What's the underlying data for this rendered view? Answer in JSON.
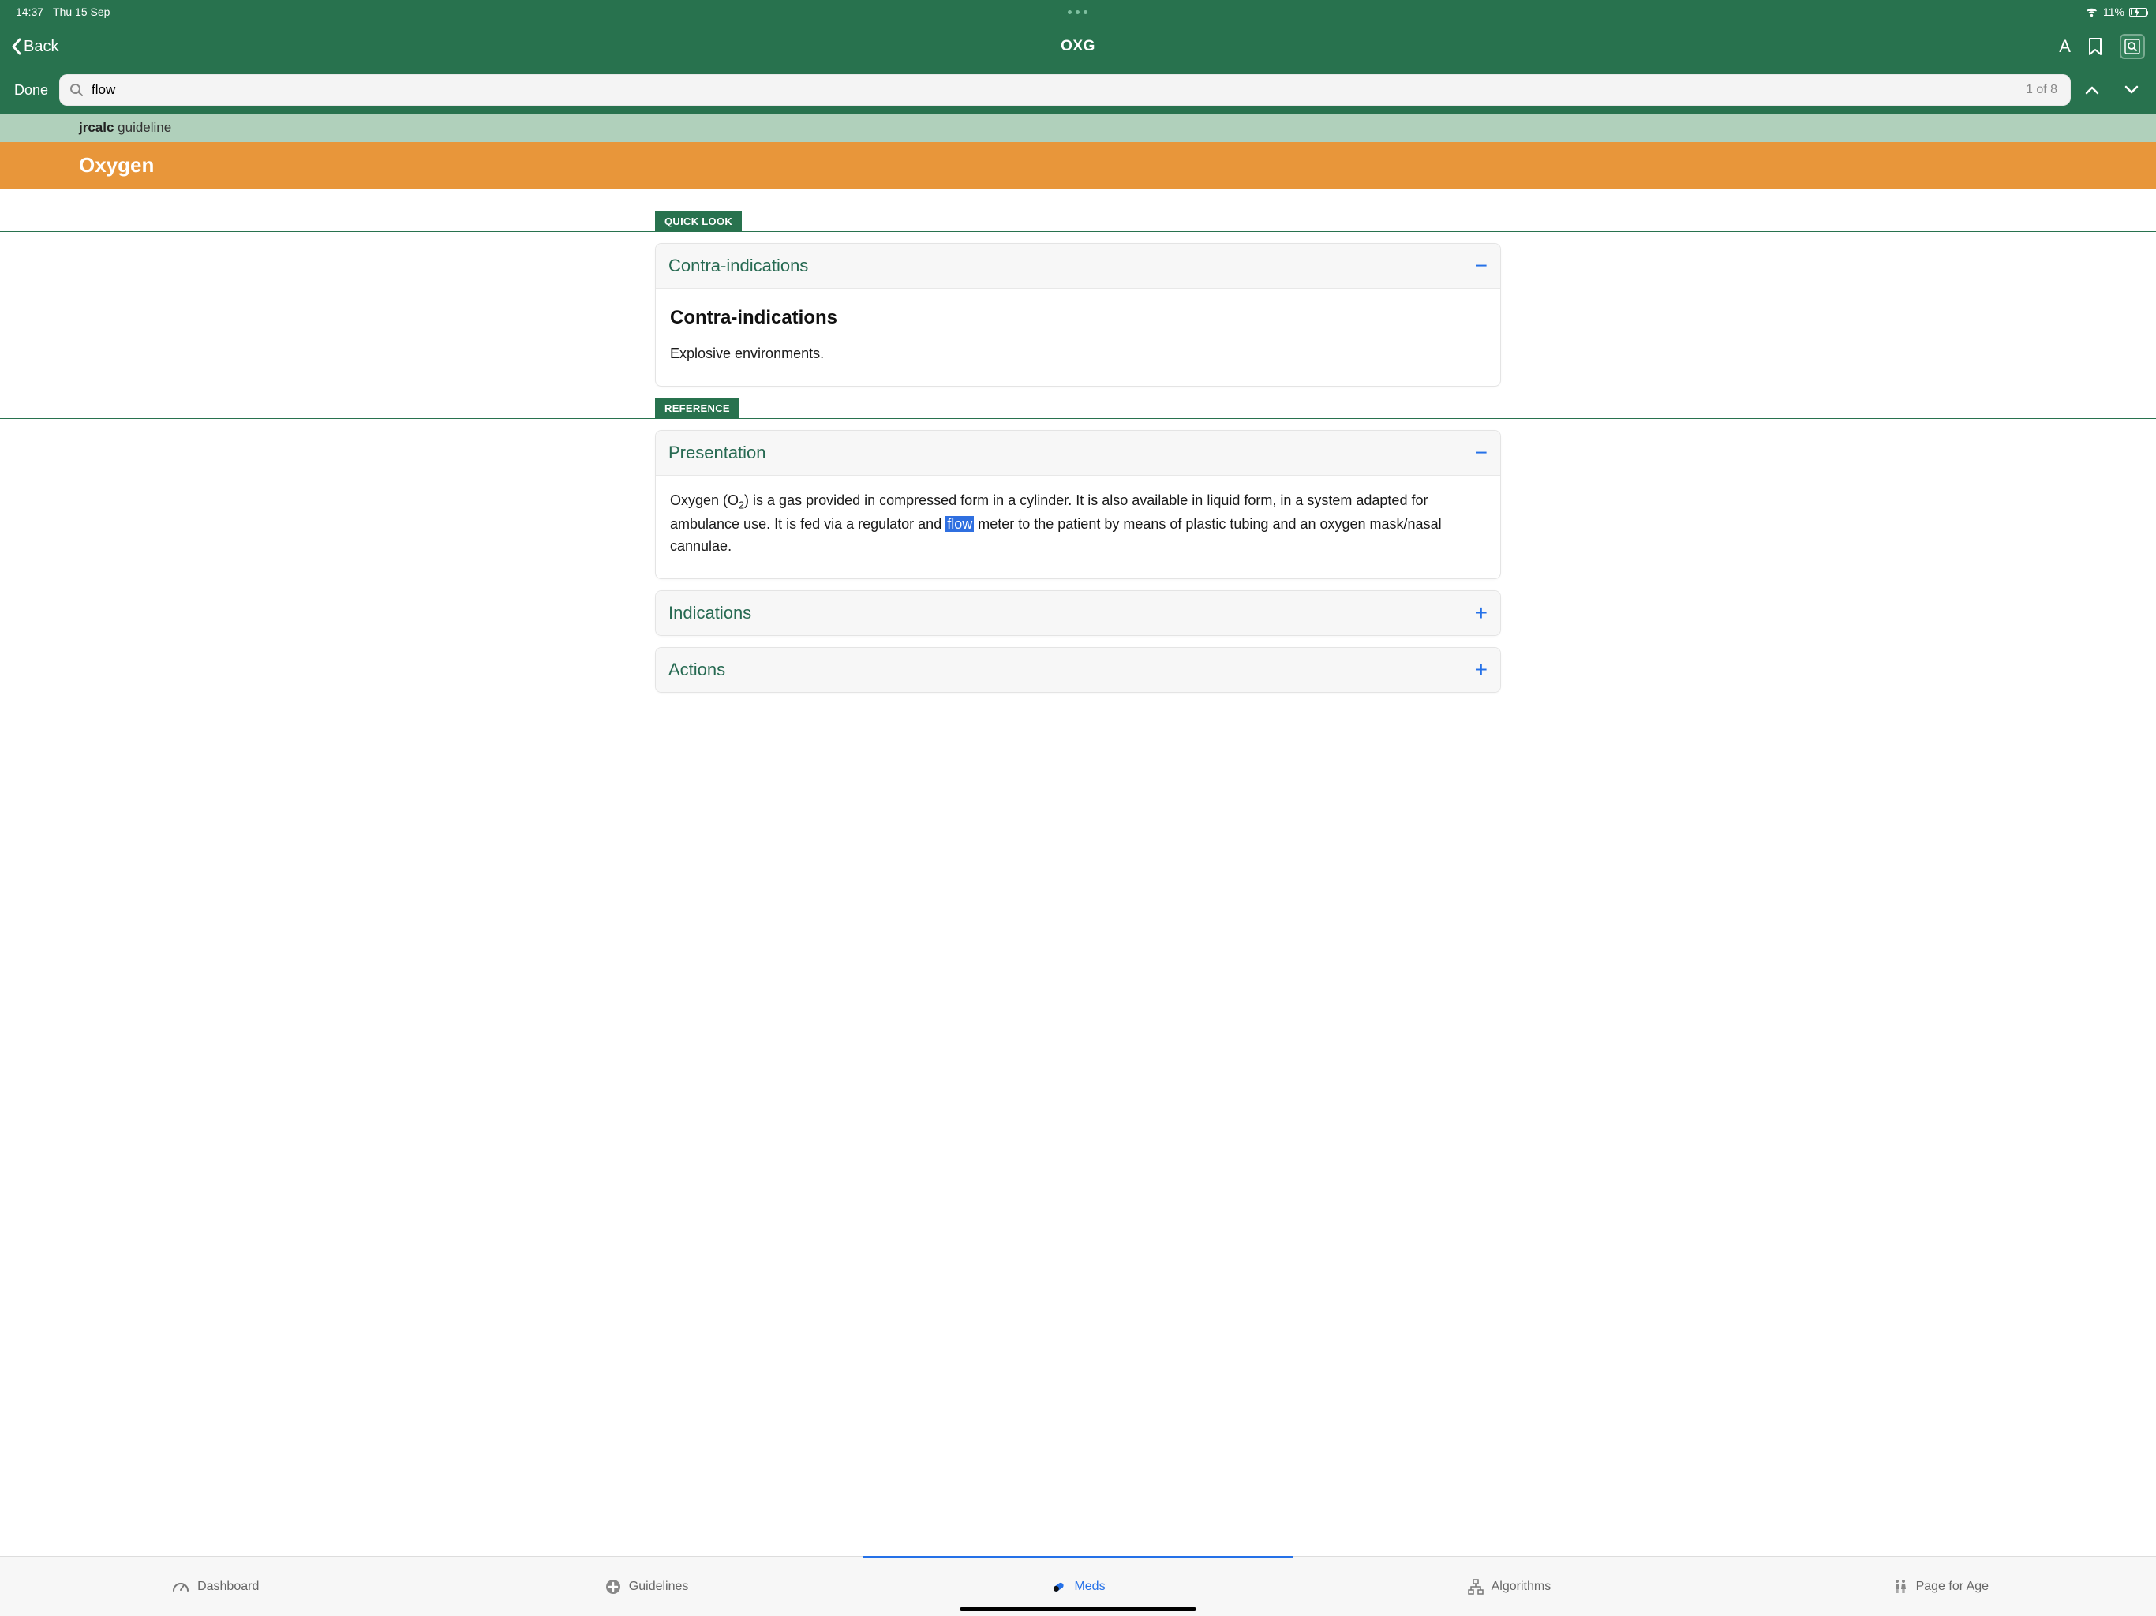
{
  "status": {
    "time": "14:37",
    "date": "Thu 15 Sep",
    "battery_pct": "11%"
  },
  "nav": {
    "back_label": "Back",
    "title": "OXG"
  },
  "search": {
    "done_label": "Done",
    "value": "flow",
    "count_label": "1 of 8"
  },
  "breadcrumb": {
    "strong": "jrcalc",
    "rest": " guideline"
  },
  "page_title": "Oxygen",
  "sections": {
    "quicklook_tag": "QUICK LOOK",
    "reference_tag": "REFERENCE",
    "contra": {
      "title": "Contra-indications",
      "body_heading": "Contra-indications",
      "body_text": "Explosive environments."
    },
    "presentation": {
      "title": "Presentation",
      "body_pre": "Oxygen (O",
      "body_sub": "2",
      "body_mid": ") is a gas provided in compressed form in a cylinder. It is also available in liquid form, in a system adapted for ambulance use. It is fed via a regulator and ",
      "body_hl": "flow",
      "body_post": " meter to the patient by means of plastic tubing and an oxygen mask/nasal cannulae."
    },
    "indications": {
      "title": "Indications"
    },
    "actions": {
      "title": "Actions"
    }
  },
  "tabs": {
    "dashboard": "Dashboard",
    "guidelines": "Guidelines",
    "meds": "Meds",
    "algorithms": "Algorithms",
    "pageforage": "Page for Age"
  }
}
